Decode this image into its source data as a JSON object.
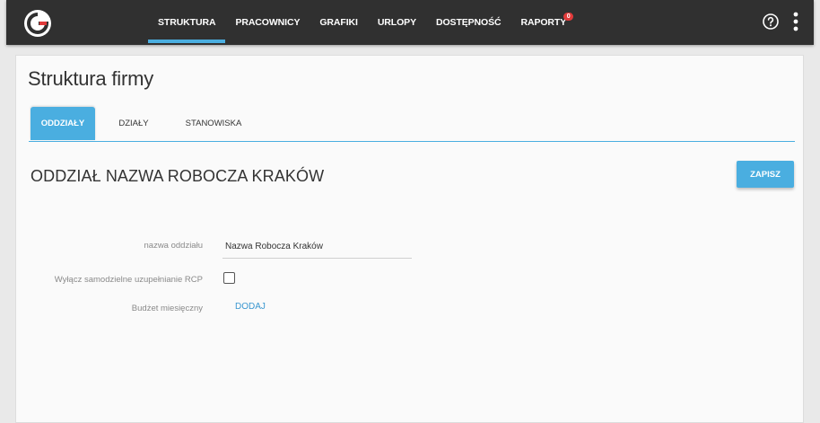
{
  "header": {
    "nav": [
      {
        "label": "STRUKTURA"
      },
      {
        "label": "PRACOWNICY"
      },
      {
        "label": "GRAFIKI"
      },
      {
        "label": "URLOPY"
      },
      {
        "label": "DOSTĘPNOŚĆ"
      },
      {
        "label": "RAPORTY",
        "badge": "0"
      }
    ],
    "icons": {
      "logo": "logo-g-icon",
      "help": "help-circle-icon",
      "menu": "more-vertical-icon"
    },
    "colors": {
      "bar": "#303030",
      "accent": "#4aaee0",
      "badge": "#e03a3a"
    }
  },
  "page": {
    "title": "Struktura firmy",
    "tabs": [
      {
        "label": "ODDZIAŁY",
        "active": true
      },
      {
        "label": "DZIAŁY",
        "active": false
      },
      {
        "label": "STANOWISKA",
        "active": false
      }
    ],
    "section_title": "ODDZIAŁ NAZWA ROBOCZA KRAKÓW",
    "save_label": "ZAPISZ"
  },
  "form": {
    "name_label": "nazwa oddziału",
    "name_value": "Nazwa Robocza Kraków",
    "rcp_label": "Wyłącz samodzielne uzupełnianie RCP",
    "rcp_checked": false,
    "budget_label": "Budżet miesięczny",
    "budget_action": "DODAJ"
  }
}
